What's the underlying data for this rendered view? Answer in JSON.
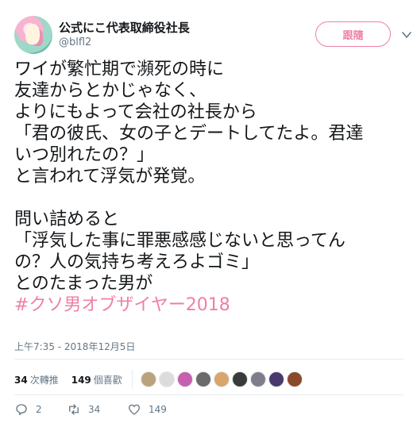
{
  "tweet": {
    "author_name": "公式にこ代表取締役社長",
    "author_handle": "@blfl2",
    "follow_label": "跟隨",
    "body_text": "ワイが繁忙期で瀕死の時に\n友達からとかじゃなく、\nよりにもよって会社の社長から\n「君の彼氏、女の子とデートしてたよ。君達\nいつ別れたの？」\nと言われて浮気が発覚。\n\n問い詰めると\n「浮気した事に罪悪感感じないと思ってん\nの？人の気持ち考えろよゴミ」\nとのたまった男が\n",
    "hashtag": "#クソ男オブザイヤー2018",
    "timestamp": "上午7:35 - 2018年12月5日",
    "retweet_count": "34",
    "retweet_label": "次轉推",
    "like_count": "149",
    "like_label": "個喜歡",
    "likers": [
      {
        "color": "#b9a37c",
        "icon": "liker-avatar"
      },
      {
        "color": "#dcdcdc",
        "icon": "liker-avatar"
      },
      {
        "color": "#c65fb0",
        "icon": "liker-avatar"
      },
      {
        "color": "#6b6b6b",
        "icon": "liker-avatar"
      },
      {
        "color": "#d9a56b",
        "icon": "liker-avatar"
      },
      {
        "color": "#3a3a3a",
        "icon": "liker-avatar"
      },
      {
        "color": "#7d7d8c",
        "icon": "liker-avatar"
      },
      {
        "color": "#4a3a6b",
        "icon": "liker-avatar"
      },
      {
        "color": "#8a4a2a",
        "icon": "liker-avatar"
      }
    ],
    "reply_count": "2",
    "action_retweet_count": "34",
    "action_like_count": "149",
    "accent_color": "#f07fa5"
  }
}
